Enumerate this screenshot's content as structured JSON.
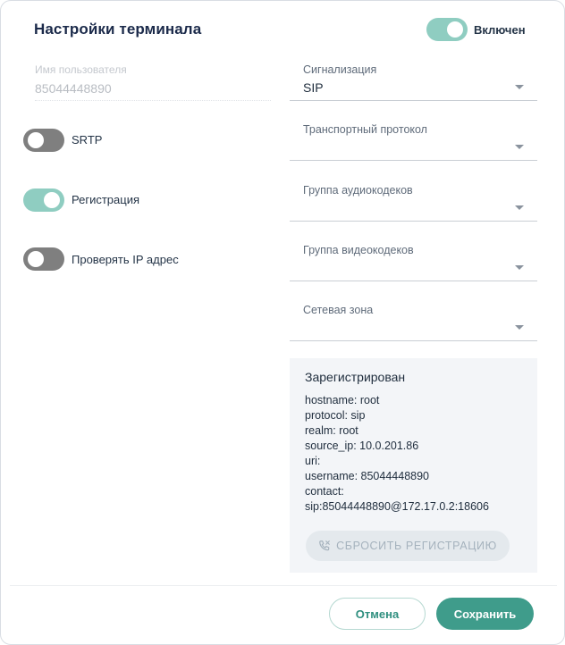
{
  "dialog": {
    "title": "Настройки терминала",
    "enabled_label": "Включен",
    "enabled": true
  },
  "username": {
    "label": "Имя пользователя",
    "value": "85044448890"
  },
  "toggles": {
    "srtp": {
      "label": "SRTP",
      "on": false
    },
    "registration": {
      "label": "Регистрация",
      "on": true
    },
    "check_ip": {
      "label": "Проверять IP адрес",
      "on": false
    }
  },
  "selects": {
    "signaling": {
      "label": "Сигнализация",
      "value": "SIP"
    },
    "transport": {
      "label": "Транспортный протокол",
      "value": ""
    },
    "audio_codecs": {
      "label": "Группа аудиокодеков",
      "value": ""
    },
    "video_codecs": {
      "label": "Группа видеокодеков",
      "value": ""
    },
    "network_zone": {
      "label": "Сетевая зона",
      "value": ""
    }
  },
  "registration_info": {
    "title": "Зарегистрирован",
    "lines": [
      "hostname: root",
      "protocol: sip",
      "realm: root",
      "source_ip: 10.0.201.86",
      "uri:",
      "username: 85044448890",
      "contact:",
      "sip:85044448890@172.17.0.2:18606"
    ],
    "reset_label": "СБРОСИТЬ РЕГИСТРАЦИЮ",
    "reset_icon": "phone-reset-icon"
  },
  "footer": {
    "cancel_label": "Отмена",
    "save_label": "Сохранить"
  },
  "colors": {
    "accent": "#3f9c8b",
    "toggle_on": "#8fcdc1",
    "toggle_off": "#7f7f7f",
    "title": "#1b2a4a",
    "panel_bg": "#f3f5f8"
  }
}
